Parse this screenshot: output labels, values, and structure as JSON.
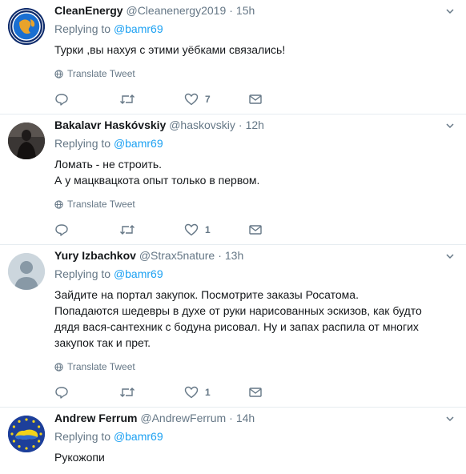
{
  "colors": {
    "link": "#1da1f2",
    "muted": "#657786",
    "text": "#14171a",
    "divider": "#e6ecf0"
  },
  "tweets": [
    {
      "name": "CleanEnergy",
      "handle": "@Cleanenergy2019",
      "time": "15h",
      "reply_prefix": "Replying to ",
      "reply_to": "@bamr69",
      "lines": [
        "Турки ,вы нахуя с этими уёбками связались!"
      ],
      "translate": "Translate Tweet",
      "reply_count": "",
      "retweet_count": "",
      "like_count": "7",
      "avatar": "globe-logo"
    },
    {
      "name": "Bakalavr Haskóvskiy",
      "handle": "@haskovskiy",
      "time": "12h",
      "reply_prefix": "Replying to ",
      "reply_to": "@bamr69",
      "lines": [
        "Ломать - не строить.",
        "А у мацквацкота опыт только в первом."
      ],
      "translate": "Translate Tweet",
      "reply_count": "",
      "retweet_count": "",
      "like_count": "1",
      "avatar": "dark-figure"
    },
    {
      "name": "Yury Izbachkov",
      "handle": "@Strax5nature",
      "time": "13h",
      "reply_prefix": "Replying to ",
      "reply_to": "@bamr69",
      "lines": [
        "Зайдите на портал закупок. Посмотрите заказы Росатома.",
        "Попадаются шедевры в духе от руки нарисованных эскизов, как будто",
        "дядя вася-сантехник с бодуна рисовал. Ну и запах распила от многих",
        "закупок так и прет."
      ],
      "translate": "Translate Tweet",
      "reply_count": "",
      "retweet_count": "",
      "like_count": "1",
      "avatar": "default-avatar"
    },
    {
      "name": "Andrew Ferrum",
      "handle": "@AndrewFerrum",
      "time": "14h",
      "reply_prefix": "Replying to ",
      "reply_to": "@bamr69",
      "lines": [
        "Рукожопи"
      ],
      "avatar": "eu-ukraine-flag"
    }
  ]
}
